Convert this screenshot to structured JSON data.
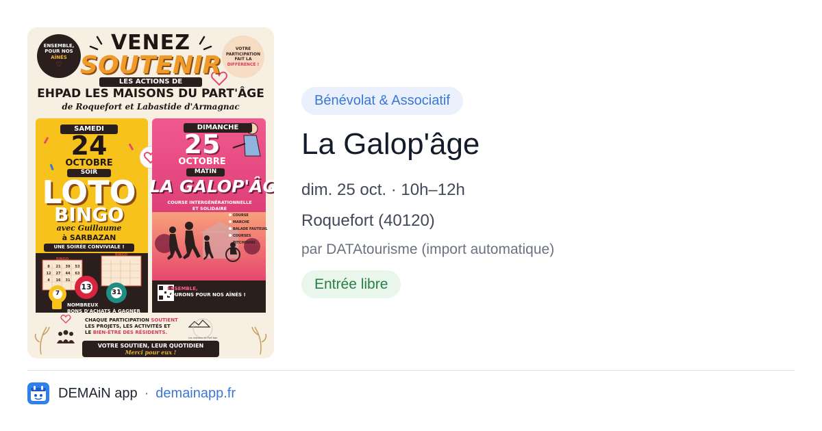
{
  "poster": {
    "seal_left": {
      "line1": "ENSEMBLE,",
      "line2": "POUR NOS",
      "line3": "AÎNÉS"
    },
    "seal_right": {
      "line1": "VOTRE",
      "line2": "PARTICIPATION",
      "line3": "FAIT LA",
      "line4": "DIFFÉRENCE !"
    },
    "headline": "VENEZ",
    "headline2": "SOUTENIR",
    "banner": "LES ACTIONS DE",
    "org": "EHPAD LES MAISONS DU PART'ÂGE",
    "towns": "de Roquefort et Labastide d'Armagnac",
    "loto": {
      "day": "SAMEDI",
      "date": "24",
      "month": "OCTOBRE",
      "moment": "SOIR",
      "title": "LOTO",
      "subtitle": "BINGO",
      "host": "avec Guillaume",
      "place": "à SARBAZAN",
      "tagline": "UNE SOIRÉE CONVIVIALE !",
      "card_label": "BINGO",
      "card_numbers": [
        "8",
        "21",
        "39",
        "53",
        "12",
        "27",
        "44",
        "63",
        "4",
        "16",
        "31"
      ],
      "balls": [
        "7",
        "13",
        "31"
      ],
      "prizes_line1": "NOMBREUX",
      "prizes_line2": "BONS D'ACHATS À GAGNER !"
    },
    "galop": {
      "day": "DIMANCHE",
      "date": "25",
      "month": "OCTOBRE",
      "moment": "MATIN",
      "title": "LA GALOP'ÂGE",
      "desc_line1": "COURSE INTERGÉNÉRATIONNELLE",
      "desc_line2": "ET SOLIDAIRE",
      "activities": [
        "COURSE",
        "MARCHE",
        "BALADE FAUTEUIL",
        "COURSES PITCHOUNS"
      ],
      "slogan_line1": "ENSEMBLE,",
      "slogan_line2": "COURONS POUR NOS AÎNÉS !"
    },
    "support": {
      "line1a": "CHAQUE PARTICIPATION ",
      "line1b": "SOUTIENT",
      "line2": "LES PROJETS, LES ACTIVITÉS ET",
      "line3a": "LE ",
      "line3b": "BIEN-ÊTRE DES RÉSIDENTS."
    },
    "footer_line1": "VOTRE SOUTIEN, LEUR QUOTIDIEN",
    "footer_line2": "Merci pour eux !",
    "logo_text1": "Les maisons du Part'âge",
    "logo_text2": "Roquefort - Labastide d'Armagnac"
  },
  "event": {
    "category": "Bénévolat & Associatif",
    "title": "La Galop'âge",
    "datetime": "dim. 25 oct. · 10h–12h",
    "location": "Roquefort (40120)",
    "organizer": "par DATAtourisme (import automatique)",
    "price": "Entrée libre"
  },
  "footer": {
    "app_name": "DEMAiN app",
    "separator": "·",
    "site": "demainapp.fr"
  },
  "colors": {
    "category_bg": "#eaf1fc",
    "category_text": "#3b76d6",
    "price_bg": "#e8f6ec",
    "price_text": "#2a7d42",
    "link": "#3b76d6",
    "title": "#141b2b"
  }
}
